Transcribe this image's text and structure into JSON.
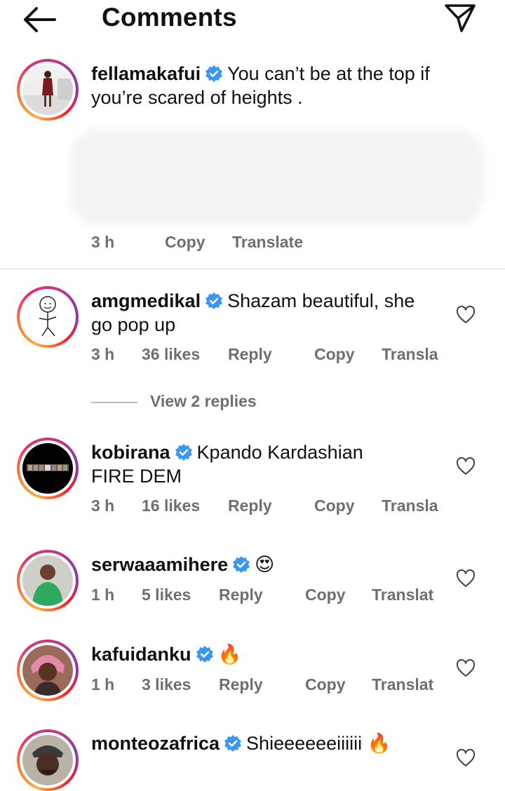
{
  "header": {
    "title": "Comments",
    "back_icon": "arrow-left-icon",
    "share_icon": "paper-plane-icon"
  },
  "caption": {
    "username": "fellamakafui",
    "text_line1": "You can’t be at the top if",
    "text_line2": "you’re scared of heights .",
    "time": "3 h",
    "copy": "Copy",
    "translate": "Translate"
  },
  "comments": [
    {
      "username": "amgmedikal",
      "line1": "Shazam beautiful, she",
      "line2": "go pop up",
      "time": "3 h",
      "likes": "36 likes",
      "reply": "Reply",
      "copy": "Copy",
      "translate": "Transla"
    },
    {
      "username": "kobirana",
      "line1": "Kpando Kardashian",
      "line2": "FIRE DEM",
      "time": "3 h",
      "likes": "16 likes",
      "reply": "Reply",
      "copy": "Copy",
      "translate": "Transla"
    },
    {
      "username": "serwaaamihere",
      "line1": "😍",
      "time": "1 h",
      "likes": "5 likes",
      "reply": "Reply",
      "copy": "Copy",
      "translate": "Translat"
    },
    {
      "username": "kafuidanku",
      "line1": "🔥",
      "time": "1 h",
      "likes": "3 likes",
      "reply": "Reply",
      "copy": "Copy",
      "translate": "Translat"
    },
    {
      "username": "monteozafrica",
      "line1": "Shieeeeeeiiiiii 🔥"
    }
  ],
  "view_replies": "View 2 replies",
  "colors": {
    "verified": "#3897f0",
    "meta": "#6f6f6f"
  }
}
